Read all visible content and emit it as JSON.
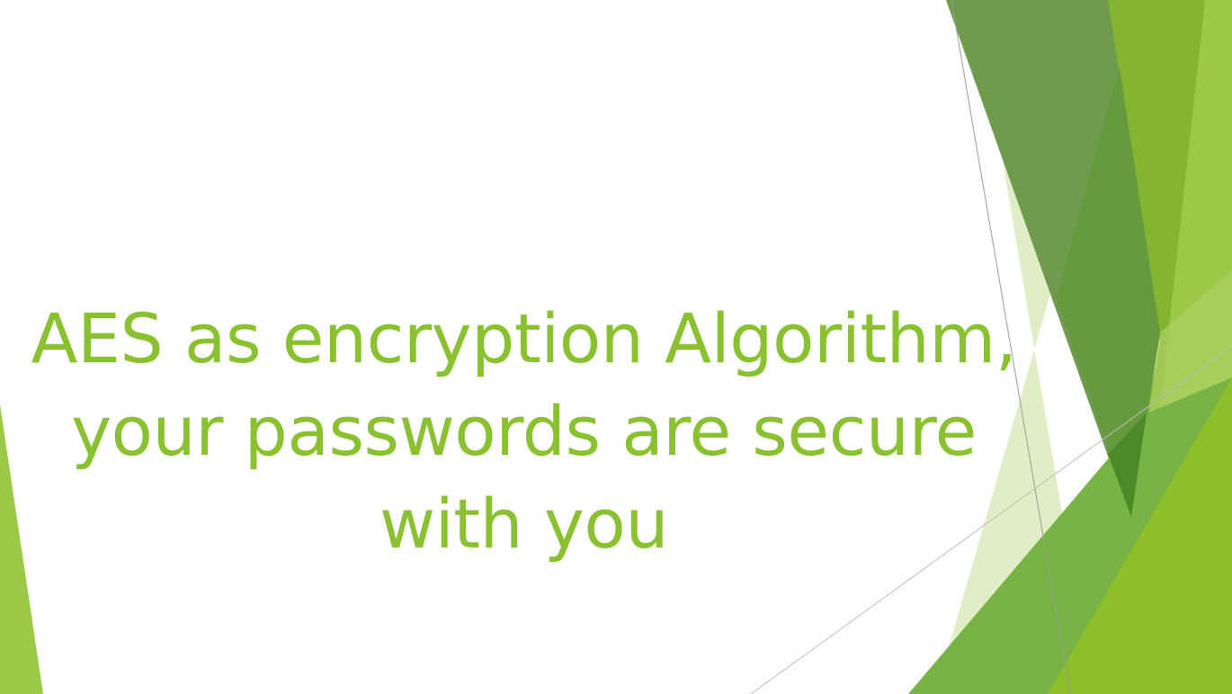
{
  "slide": {
    "title_lines": [
      "AES as encryption Algorithm,",
      "your passwords are secure",
      "with you"
    ]
  },
  "colors": {
    "title": "#8ac130",
    "background": "#ffffff",
    "green_light": "#9bc947",
    "green_mid": "#84b530",
    "green_dark": "#5f8f3a",
    "green_pale": "#dfeec4",
    "green_bright": "#8fbe2b"
  }
}
